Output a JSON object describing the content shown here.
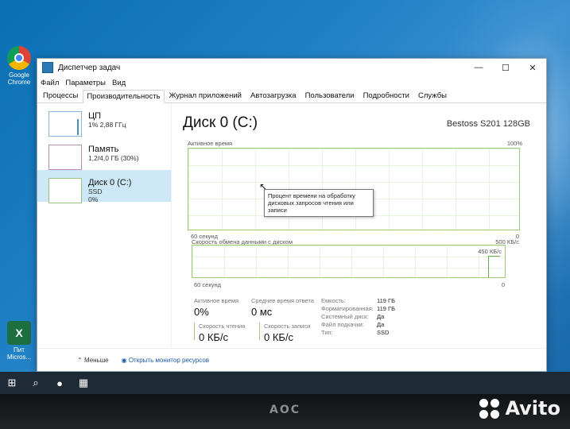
{
  "desktop": {
    "icons": [
      {
        "label": "Google\nChrome",
        "icon": "chrome-icon"
      },
      {
        "label": "Пит\nMicros...",
        "icon": "excel-icon"
      }
    ]
  },
  "window": {
    "title": "Диспетчер задач",
    "controls": {
      "minimize": "—",
      "maximize": "☐",
      "close": "✕"
    },
    "menu": [
      "Файл",
      "Параметры",
      "Вид"
    ],
    "tabs": [
      "Процессы",
      "Производительность",
      "Журнал приложений",
      "Автозагрузка",
      "Пользователи",
      "Подробности",
      "Службы"
    ],
    "active_tab": 1
  },
  "sidebar": {
    "items": [
      {
        "name": "ЦП",
        "detail": "1% 2,88 ГГц"
      },
      {
        "name": "Память",
        "detail": "1,2/4,0 ГБ (30%)"
      },
      {
        "name": "Диск 0 (C:)",
        "detail": "SSD",
        "detail2": "0%"
      }
    ]
  },
  "main": {
    "title": "Диск 0 (C:)",
    "model": "Bestoss S201 128GB",
    "graph1_label": "Активное время",
    "graph1_max": "100%",
    "graph1_time": "60 секунд",
    "graph1_min": "0",
    "graph2_label": "Скорость обмена данными с диском",
    "graph2_max": "500 КБ/с",
    "graph2_peak": "450 КБ/с",
    "graph2_time": "60 секунд",
    "graph2_min": "0",
    "tooltip": "Процент времени на обработку дисковых запросов чтения или записи",
    "stats": {
      "active_label": "Активное время",
      "active_value": "0%",
      "resp_label": "Среднее время ответа",
      "resp_value": "0 мс",
      "read_label": "Скорость чтения",
      "read_value": "0 КБ/с",
      "write_label": "Скорость записи",
      "write_value": "0 КБ/с"
    },
    "properties": [
      {
        "key": "Емкость:",
        "value": "119 ГБ"
      },
      {
        "key": "Форматированная:",
        "value": "119 ГБ"
      },
      {
        "key": "Системный диск:",
        "value": "Да"
      },
      {
        "key": "Файл подкачки:",
        "value": "Да"
      },
      {
        "key": "Тип:",
        "value": "SSD"
      }
    ]
  },
  "footer": {
    "less": "Меньше",
    "monitor": "Открыть монитор ресурсов"
  },
  "brand": "AOC",
  "watermark": "Avito"
}
